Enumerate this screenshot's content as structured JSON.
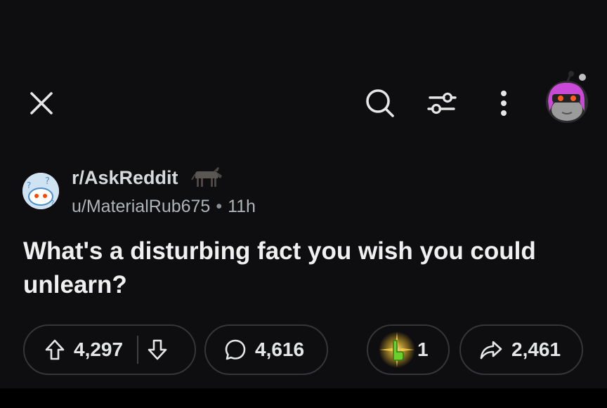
{
  "topbar": {
    "close_icon": "close-icon",
    "search_icon": "search-icon",
    "filter_icon": "filter-icon",
    "more_icon": "more-vertical-icon",
    "avatar_icon": "user-avatar"
  },
  "post": {
    "subreddit": "r/AskReddit",
    "author": "u/MaterialRub675",
    "separator": "•",
    "age": "11h",
    "title": "What's a disturbing fact you wish you could unlearn?",
    "upvotes": "4,297",
    "comments": "4,616",
    "awards": "1",
    "shares": "2,461"
  },
  "colors": {
    "background": "#0e0e10",
    "pill_border": "#34363a",
    "avatar_hair": "#c94ad6",
    "award_green": "#6ccf2a"
  }
}
